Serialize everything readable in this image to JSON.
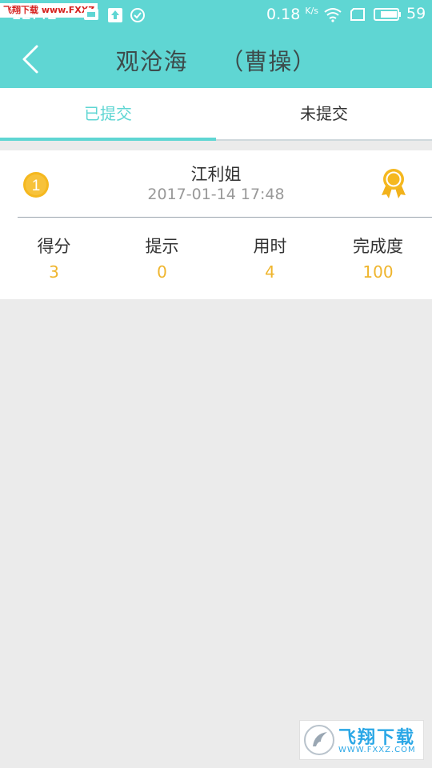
{
  "status_bar": {
    "time": "12:42",
    "network_speed": "0.18",
    "speed_unit": "K/s",
    "battery_level": "59",
    "watermark_text": "飞翔下载 www.FXXZ.com"
  },
  "header": {
    "back_icon": "chevron-left-icon",
    "title": "观沧海    （曹操）"
  },
  "tabs": [
    {
      "label": "已提交",
      "active": true
    },
    {
      "label": "未提交",
      "active": false
    }
  ],
  "record": {
    "rank": "1",
    "name": "江利姐",
    "submitted_at": "2017-01-14 17:48",
    "medal_icon": "medal-icon",
    "stats": [
      {
        "label": "得分",
        "value": "3"
      },
      {
        "label": "提示",
        "value": "0"
      },
      {
        "label": "用时",
        "value": "4"
      },
      {
        "label": "完成度",
        "value": "100"
      }
    ]
  },
  "watermark": {
    "text": "飞翔下载",
    "url": "WWW.FXXZ.COM"
  },
  "colors": {
    "accent": "#5fd6d3",
    "value": "#efb52d",
    "background": "#ebebeb"
  }
}
